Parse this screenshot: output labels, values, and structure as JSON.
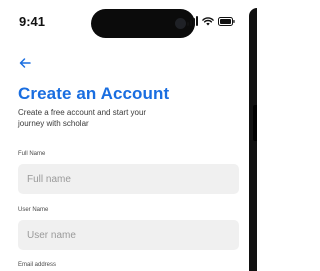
{
  "status_bar": {
    "time": "9:41",
    "icons": [
      "signal-icon",
      "wifi-icon",
      "battery-icon"
    ]
  },
  "header": {
    "back_icon": "arrow-left-icon",
    "title": "Create an Account",
    "subtitle": "Create a free account and start your journey with scholar"
  },
  "form": {
    "fields": [
      {
        "label": "Full Name",
        "placeholder": "Full name",
        "value": ""
      },
      {
        "label": "User Name",
        "placeholder": "User name",
        "value": ""
      },
      {
        "label": "Email address",
        "placeholder": "",
        "value": ""
      }
    ]
  },
  "colors": {
    "accent": "#1a6ee0",
    "input_bg": "#f0f0f0",
    "placeholder": "#9a9a9a"
  }
}
